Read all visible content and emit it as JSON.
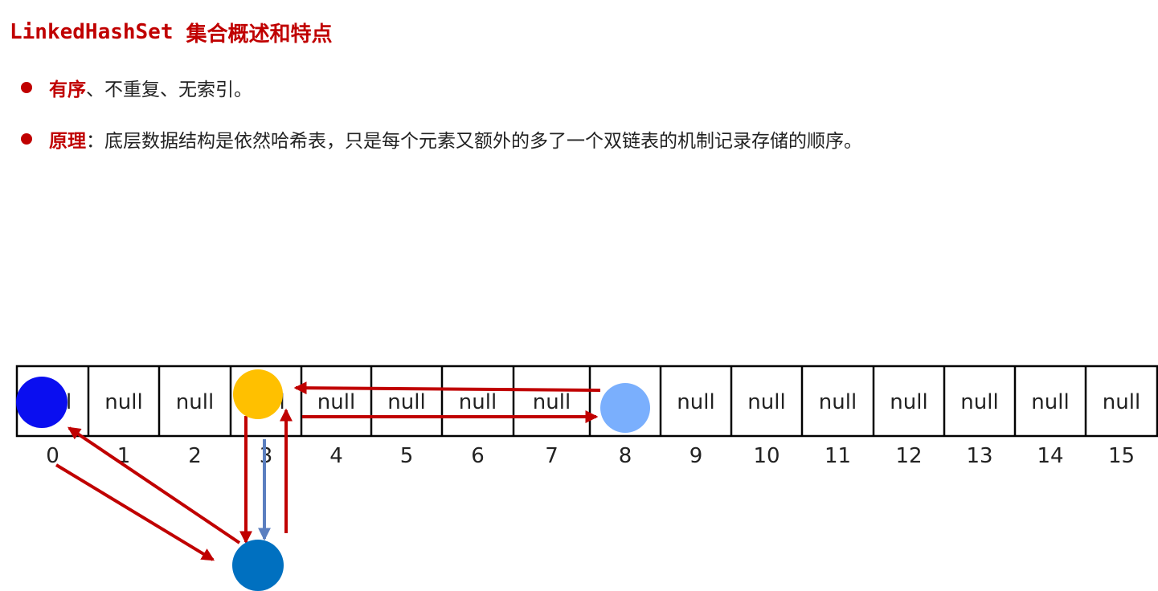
{
  "title": {
    "code": "LinkedHashSet",
    "text": "集合概述和特点"
  },
  "bullets": [
    {
      "key": "有序",
      "text": "、不重复、无索引。"
    },
    {
      "key": "原理",
      "text": "：底层数据结构是依然哈希表，只是每个元素又额外的多了一个双链表的机制记录存储的顺序。"
    }
  ],
  "table": {
    "cells": [
      "null",
      "null",
      "null",
      "null",
      "null",
      "null",
      "null",
      "null",
      "null",
      "null",
      "null",
      "null",
      "null",
      "null",
      "null",
      "null"
    ],
    "indices": [
      "0",
      "1",
      "2",
      "3",
      "4",
      "5",
      "6",
      "7",
      "8",
      "9",
      "10",
      "11",
      "12",
      "13",
      "14",
      "15"
    ]
  },
  "colors": {
    "accent": "#c00000",
    "arrow_red": "#c00000",
    "arrow_blue": "#5b7fc0",
    "node_bucket0": "#0a0ef0",
    "node_bucket3": "#ffc000",
    "node_bucket8": "#7aaffd",
    "node_chain": "#0070c0",
    "grid": "#000000"
  }
}
